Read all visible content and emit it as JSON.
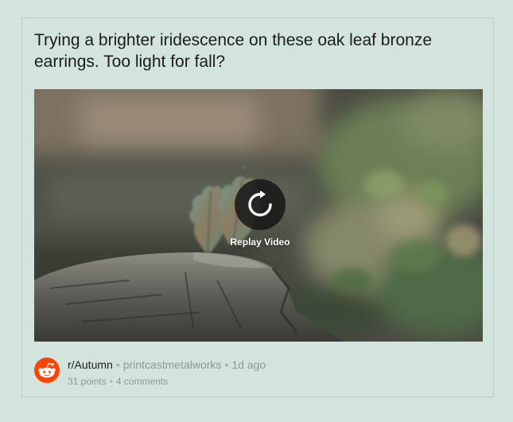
{
  "post": {
    "title": "Trying a brighter iridescence on these oak leaf bronze earrings. Too light for fall?"
  },
  "video": {
    "replay_label": "Replay Video",
    "icon": "replay-icon"
  },
  "meta": {
    "subreddit": "r/Autumn",
    "separator": "•",
    "author": "printcastmetalworks",
    "age": "1d ago",
    "points": "31 points",
    "comments": "4 comments"
  },
  "colors": {
    "page_background": "#d2e4dd",
    "card_border": "#bccbc5",
    "reddit_orange": "#ff4500",
    "title_text": "#1c1c1c",
    "muted_text": "#8f9994"
  },
  "icons": {
    "avatar": "reddit-snoo-icon"
  }
}
